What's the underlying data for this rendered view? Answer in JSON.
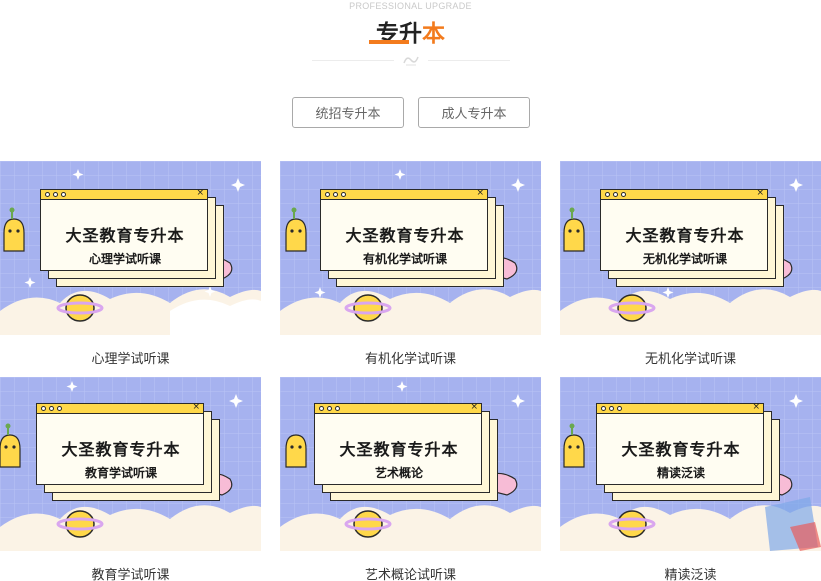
{
  "header": {
    "eyebrow": "PROFESSIONAL UPGRADE",
    "title_main": "专升",
    "title_accent": "本",
    "accent_color": "#f37b1d"
  },
  "tabs": [
    {
      "label": "统招专升本"
    },
    {
      "label": "成人专升本"
    }
  ],
  "courses": [
    {
      "banner_title": "大圣教育专升本",
      "banner_subtitle": "心理学试听课",
      "caption": "心理学试听课"
    },
    {
      "banner_title": "大圣教育专升本",
      "banner_subtitle": "有机化学试听课",
      "caption": "有机化学试听课"
    },
    {
      "banner_title": "大圣教育专升本",
      "banner_subtitle": "无机化学试听课",
      "caption": "无机化学试听课"
    },
    {
      "banner_title": "大圣教育专升本",
      "banner_subtitle": "教育学试听课",
      "caption": "教育学试听课"
    },
    {
      "banner_title": "大圣教育专升本",
      "banner_subtitle": "艺术概论",
      "caption": "艺术概论试听课"
    },
    {
      "banner_title": "大圣教育专升本",
      "banner_subtitle": "精读泛读",
      "caption": "精读泛读"
    }
  ]
}
